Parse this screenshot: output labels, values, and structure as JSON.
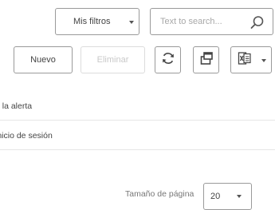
{
  "toolbar": {
    "filters_label": "Mis filtros",
    "search_placeholder": "Text to search...",
    "new_label": "Nuevo",
    "delete_label": "Eliminar"
  },
  "icons": {
    "search": "search-icon",
    "refresh": "refresh-icon",
    "export": "export-icon",
    "excel": "excel-icon"
  },
  "rows": [
    {
      "label": "e la alerta"
    },
    {
      "label": "inicio de sesión"
    }
  ],
  "pagination": {
    "page_size_label": "Tamaño de página",
    "page_size_value": "20"
  },
  "colors": {
    "border": "#9a9a9a",
    "disabled_text": "#c9c9c9",
    "row_divider": "#e6e6e6"
  }
}
